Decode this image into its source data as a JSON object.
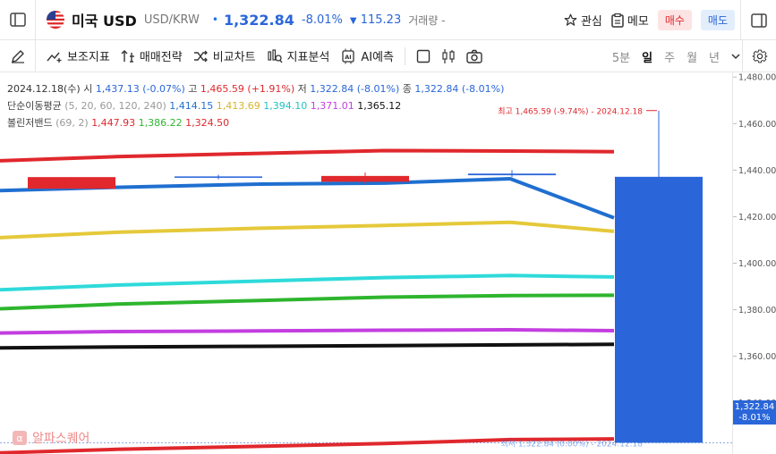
{
  "header": {
    "title": "미국 USD",
    "subtitle": "USD/KRW",
    "price": "1,322.84",
    "change_pct": "-8.01%",
    "change_abs": "115.23",
    "volume_label": "거래량 -",
    "favorite_label": "관심",
    "memo_label": "메모",
    "buy_label": "매수",
    "sell_label": "매도",
    "colors": {
      "up": "#e0282d",
      "down": "#2a66d9"
    }
  },
  "toolbar": {
    "items": [
      "보조지표",
      "매매전략",
      "비교차트",
      "지표분석",
      "AI예측"
    ],
    "periods": [
      "5분",
      "일",
      "주",
      "월",
      "년"
    ],
    "active_period": "일"
  },
  "legend": {
    "ohlc": {
      "date": "2024.12.18(수)",
      "open_label": "시",
      "open": "1,437.13 (-0.07%)",
      "high_label": "고",
      "high": "1,465.59 (+1.91%)",
      "low_label": "저",
      "low": "1,322.84 (-8.01%)",
      "close_label": "종",
      "close": "1,322.84 (-8.01%)"
    },
    "ma": {
      "label": "단순이동평균",
      "params": "(5, 20, 60, 120, 240)",
      "values": [
        "1,414.15",
        "1,413.69",
        "1,394.10",
        "1,371.01",
        "1,365.12"
      ],
      "colors": [
        "#1f6fd0",
        "#e5c93a",
        "#2fdada",
        "#c33ee0",
        "#111111"
      ]
    },
    "bollinger": {
      "label": "볼린저밴드",
      "params": "(69, 2)",
      "values": [
        "1,447.93",
        "1,386.22",
        "1,324.50"
      ],
      "colors": [
        "#e0282d",
        "#2eb52e",
        "#e0282d"
      ]
    }
  },
  "annotations": {
    "high": "최고 1,465.59 (-9.74%) - 2024.12.18",
    "low": "최저 1,322.84 (0.00%) - 2024.12.18"
  },
  "yaxis": {
    "ticks": [
      "1,480.00",
      "1,460.00",
      "1,440.00",
      "1,420.00",
      "1,400.00",
      "1,380.00",
      "1,360.00",
      "1,340.00"
    ],
    "current_price": "1,322.84",
    "current_change": "-8.01%"
  },
  "brand": "알파스퀘어",
  "chart_data": {
    "type": "line",
    "ylim": [
      1318,
      1482
    ],
    "candles": [
      {
        "open": 1432,
        "close": 1437,
        "high": 1437,
        "low": 1432,
        "color": "up"
      },
      {
        "open": 1437.3,
        "close": 1436.7,
        "high": 1438,
        "low": 1436,
        "color": "down"
      },
      {
        "open": 1435,
        "close": 1437.5,
        "high": 1439,
        "low": 1434,
        "color": "up"
      },
      {
        "open": 1438.5,
        "close": 1437.8,
        "high": 1440,
        "low": 1437,
        "color": "down"
      },
      {
        "open": 1437.13,
        "close": 1322.84,
        "high": 1465.59,
        "low": 1322.84,
        "color": "down"
      }
    ],
    "series": [
      {
        "key": "ma5",
        "values": [
          1431.2,
          1432.6,
          1434.0,
          1434.4,
          1436.3,
          1419.5
        ]
      },
      {
        "key": "ma20",
        "values": [
          1411.0,
          1413.3,
          1415.0,
          1416.2,
          1417.6,
          1413.69
        ]
      },
      {
        "key": "ma60",
        "values": [
          1388.6,
          1390.6,
          1392.3,
          1393.8,
          1394.7,
          1394.1
        ]
      },
      {
        "key": "ma120",
        "values": [
          1370.0,
          1370.6,
          1370.9,
          1371.2,
          1371.4,
          1371.01
        ]
      },
      {
        "key": "ma240",
        "values": [
          1363.6,
          1364.0,
          1364.3,
          1364.6,
          1364.9,
          1365.12
        ]
      },
      {
        "key": "bb_upper",
        "values": [
          1444.0,
          1445.8,
          1447.2,
          1448.4,
          1448.2,
          1447.93
        ]
      },
      {
        "key": "bb_mid",
        "values": [
          1380.4,
          1382.4,
          1384.0,
          1385.4,
          1386.1,
          1386.22
        ]
      },
      {
        "key": "bb_lower",
        "values": [
          1318.5,
          1320.0,
          1321.3,
          1322.5,
          1324.2,
          1324.5
        ]
      }
    ]
  }
}
